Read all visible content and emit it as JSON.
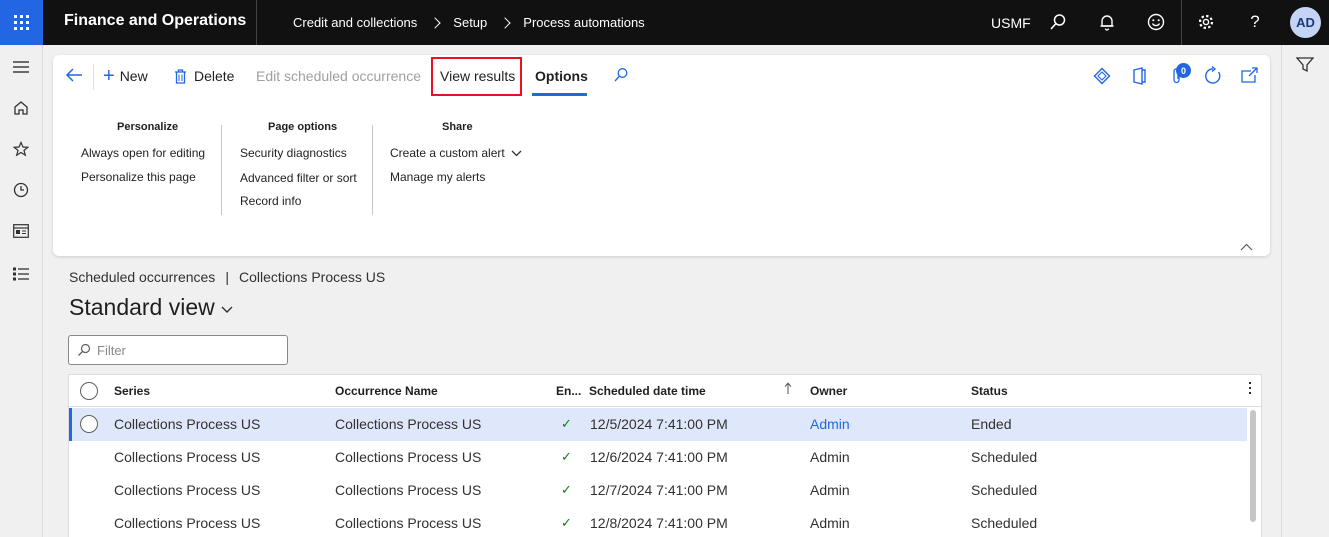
{
  "topbar": {
    "app_name": "Finance and Operations",
    "breadcrumbs": [
      "Credit and collections",
      "Setup",
      "Process automations"
    ],
    "company": "USMF",
    "avatar_initials": "AD"
  },
  "action_pane": {
    "new_label": "New",
    "delete_label": "Delete",
    "edit_label": "Edit scheduled occurrence",
    "view_results_label": "View results",
    "options_tab_label": "Options",
    "notification_count": "0",
    "groups": {
      "personalize": {
        "title": "Personalize",
        "links": [
          "Always open for editing",
          "Personalize this page"
        ]
      },
      "page_options": {
        "title": "Page options",
        "links": [
          "Security diagnostics",
          "Advanced filter or sort",
          "Record info"
        ]
      },
      "share": {
        "title": "Share",
        "links": [
          "Create a custom alert",
          "Manage my alerts"
        ]
      }
    }
  },
  "page": {
    "breadcrumb_left": "Scheduled occurrences",
    "breadcrumb_sep": "|",
    "breadcrumb_right": "Collections Process US",
    "view_title": "Standard view",
    "filter_placeholder": "Filter"
  },
  "grid": {
    "columns": [
      "Series",
      "Occurrence Name",
      "En...",
      "Scheduled date time",
      "Owner",
      "Status"
    ],
    "rows": [
      {
        "series": "Collections Process US",
        "occurrence": "Collections Process US",
        "enabled": "✓",
        "datetime": "12/5/2024 7:41:00 PM",
        "owner": "Admin",
        "status": "Ended"
      },
      {
        "series": "Collections Process US",
        "occurrence": "Collections Process US",
        "enabled": "✓",
        "datetime": "12/6/2024 7:41:00 PM",
        "owner": "Admin",
        "status": "Scheduled"
      },
      {
        "series": "Collections Process US",
        "occurrence": "Collections Process US",
        "enabled": "✓",
        "datetime": "12/7/2024 7:41:00 PM",
        "owner": "Admin",
        "status": "Scheduled"
      },
      {
        "series": "Collections Process US",
        "occurrence": "Collections Process US",
        "enabled": "✓",
        "datetime": "12/8/2024 7:41:00 PM",
        "owner": "Admin",
        "status": "Scheduled"
      }
    ]
  },
  "colors": {
    "accent": "#2266e3",
    "highlight_border": "#e81123",
    "check": "#107c10",
    "topbar": "#111111"
  }
}
